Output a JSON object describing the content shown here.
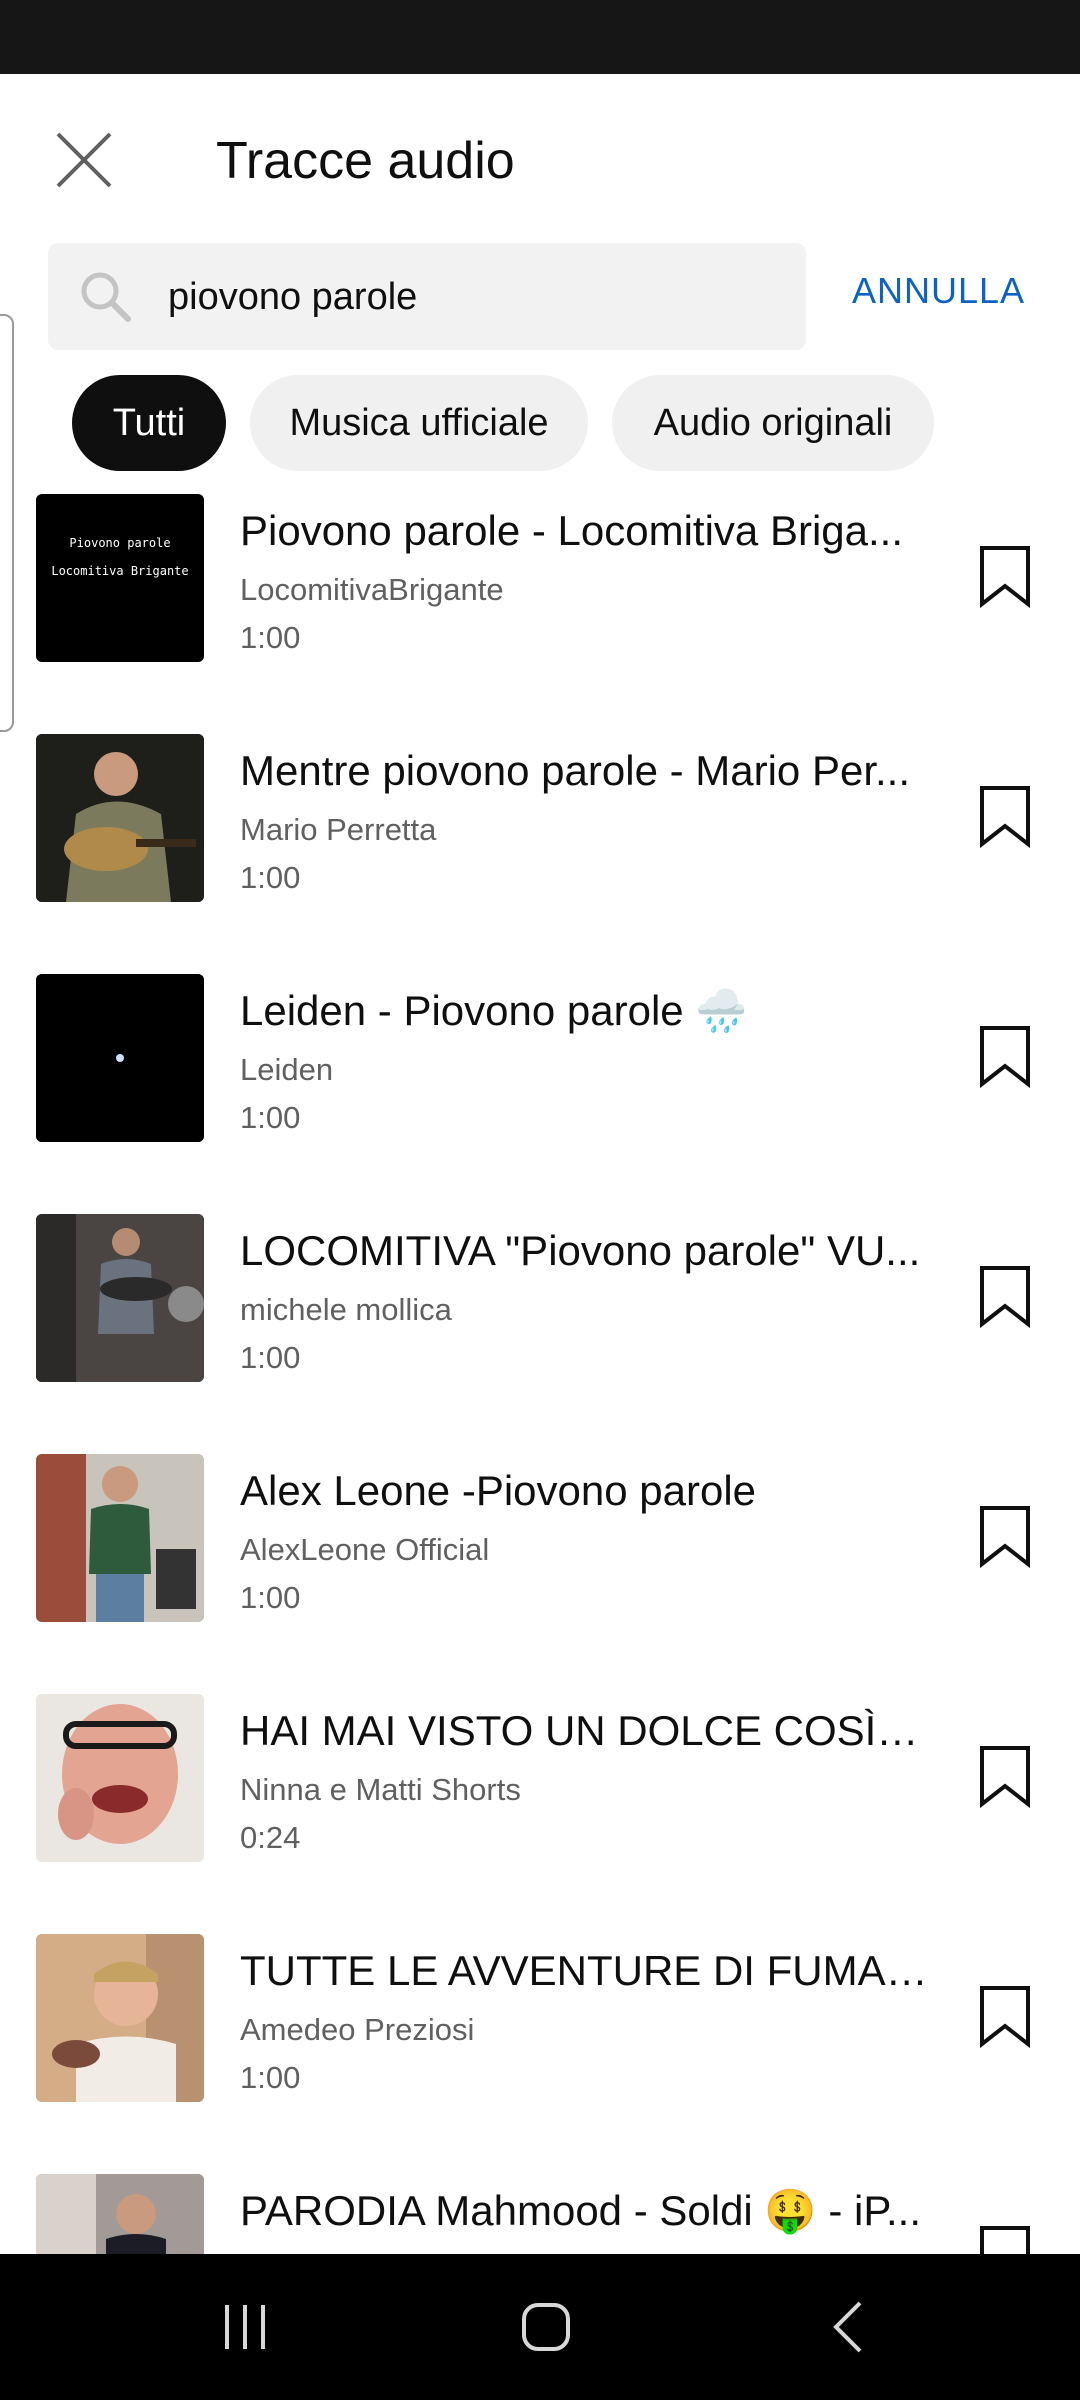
{
  "header": {
    "title": "Tracce audio",
    "close_icon": "close-icon"
  },
  "search": {
    "value": "piovono parole",
    "placeholder": "",
    "cancel_label": "ANNULLA",
    "icon": "search-icon"
  },
  "filters": [
    {
      "label": "Tutti",
      "active": true
    },
    {
      "label": "Musica ufficiale",
      "active": false
    },
    {
      "label": "Audio originali",
      "active": false
    }
  ],
  "tracks": [
    {
      "title": "Piovono parole - Locomitiva Briga...",
      "channel": "LocomitivaBrigante",
      "duration": "1:00",
      "thumb_text_1": "Piovono parole",
      "thumb_text_2": "Locomitiva Brigante"
    },
    {
      "title": "Mentre piovono parole - Mario Per...",
      "channel": "Mario Perretta",
      "duration": "1:00"
    },
    {
      "title": "Leiden - Piovono parole 🌧️",
      "channel": "Leiden",
      "duration": "1:00"
    },
    {
      "title": "LOCOMITIVA  \"Piovono parole\" VU...",
      "channel": "michele mollica",
      "duration": "1:00"
    },
    {
      "title": "Alex Leone -Piovono parole",
      "channel": "AlexLeone Official",
      "duration": "1:00"
    },
    {
      "title": "HAI MAI VISTO UN DOLCE COSÌ? -...",
      "channel": "Ninna e Matti Shorts",
      "duration": "0:24"
    },
    {
      "title": "TUTTE LE AVVENTURE DI FUMAG...",
      "channel": "Amedeo Preziosi",
      "duration": "1:00"
    },
    {
      "title": "PARODIA Mahmood - Soldi 🤑 - iP...",
      "channel": "",
      "duration": ""
    }
  ],
  "navbar": {
    "recents_icon": "recents-icon",
    "home_icon": "home-icon",
    "back_icon": "back-icon"
  }
}
